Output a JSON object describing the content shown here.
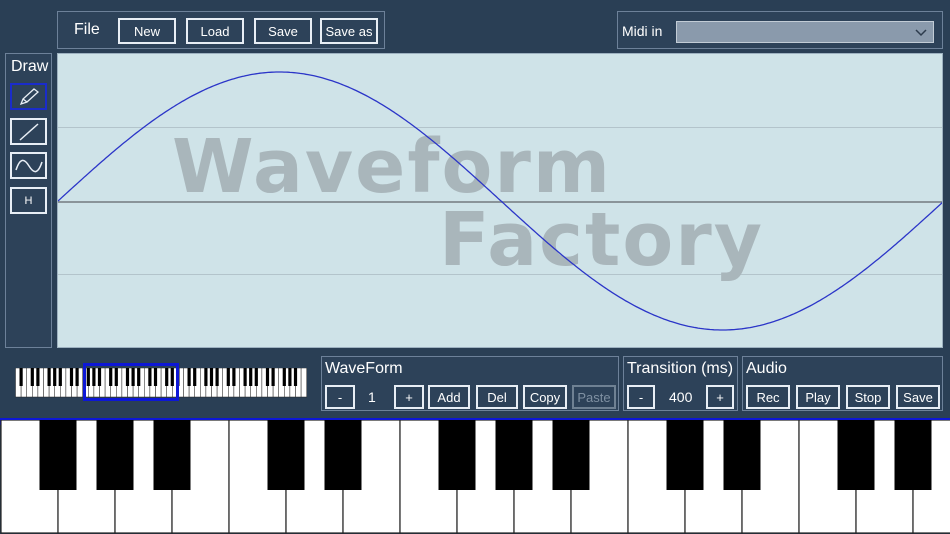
{
  "file_panel": {
    "title": "File",
    "new_label": "New",
    "load_label": "Load",
    "save_label": "Save",
    "save_as_label": "Save as"
  },
  "midi": {
    "label": "Midi in",
    "selected": ""
  },
  "draw_panel": {
    "title": "Draw",
    "tools": [
      {
        "name": "pencil-icon"
      },
      {
        "name": "line-icon"
      },
      {
        "name": "curve-icon"
      },
      {
        "label": "H"
      }
    ]
  },
  "canvas": {
    "watermark_line1": "Waveform",
    "watermark_line2": "Factory",
    "waveform": "sine",
    "wave_color": "#2b35c8"
  },
  "waveform_panel": {
    "title": "WaveForm",
    "minus": "-",
    "value": "1",
    "plus": "+",
    "add": "Add",
    "del": "Del",
    "copy": "Copy",
    "paste": "Paste"
  },
  "transition_panel": {
    "title": "Transition (ms)",
    "minus": "-",
    "value": "400",
    "plus": "+"
  },
  "audio_panel": {
    "title": "Audio",
    "rec": "Rec",
    "play": "Play",
    "stop": "Stop",
    "save": "Save"
  },
  "colors": {
    "background": "#2a3f55",
    "canvas": "#cfe3e8",
    "accent": "#0d17d6"
  }
}
